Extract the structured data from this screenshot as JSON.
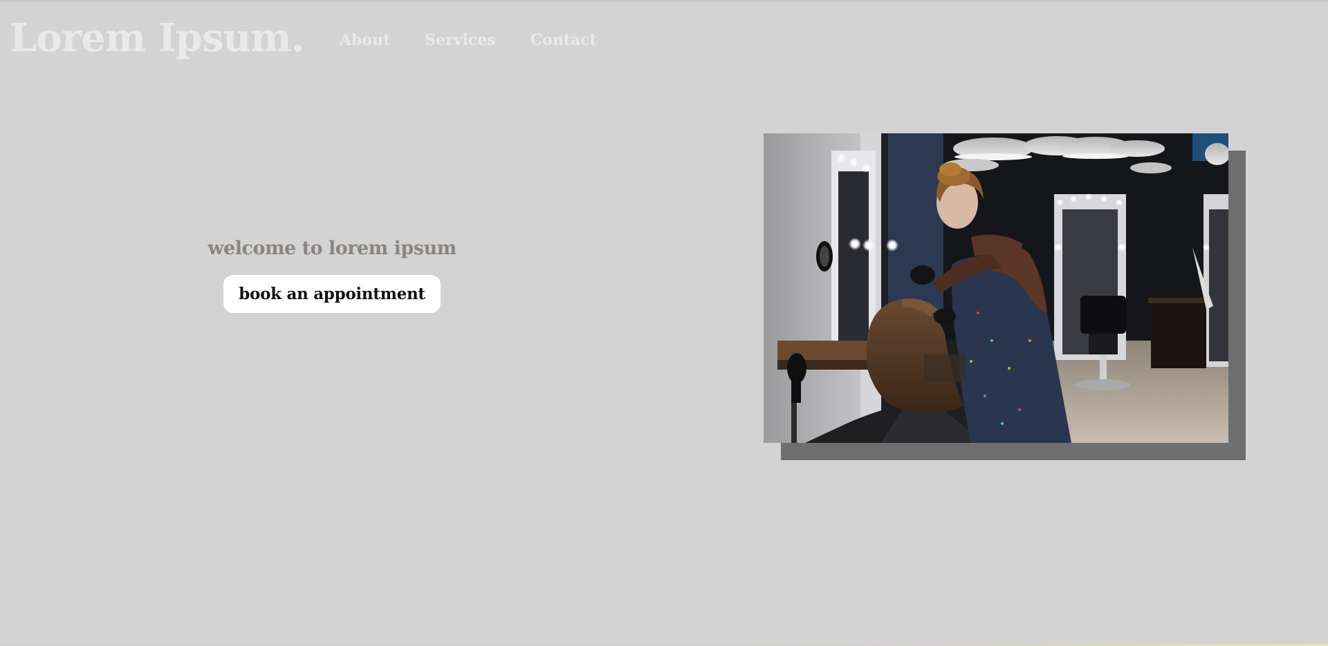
{
  "header": {
    "brand": "Lorem Ipsum.",
    "nav": [
      {
        "label": "About"
      },
      {
        "label": "Services"
      },
      {
        "label": "Contact"
      }
    ]
  },
  "hero": {
    "welcome": "welcome to lorem ipsum",
    "cta_label": "book an appointment"
  },
  "photo": {
    "subject": "hair-salon-photo"
  },
  "colors": {
    "background": "#d3d3d3",
    "nav_text": "#e9e9e9",
    "welcome_text": "#8a8580",
    "button_bg": "#ffffff",
    "photo_shadow": "#6e6e6e"
  }
}
